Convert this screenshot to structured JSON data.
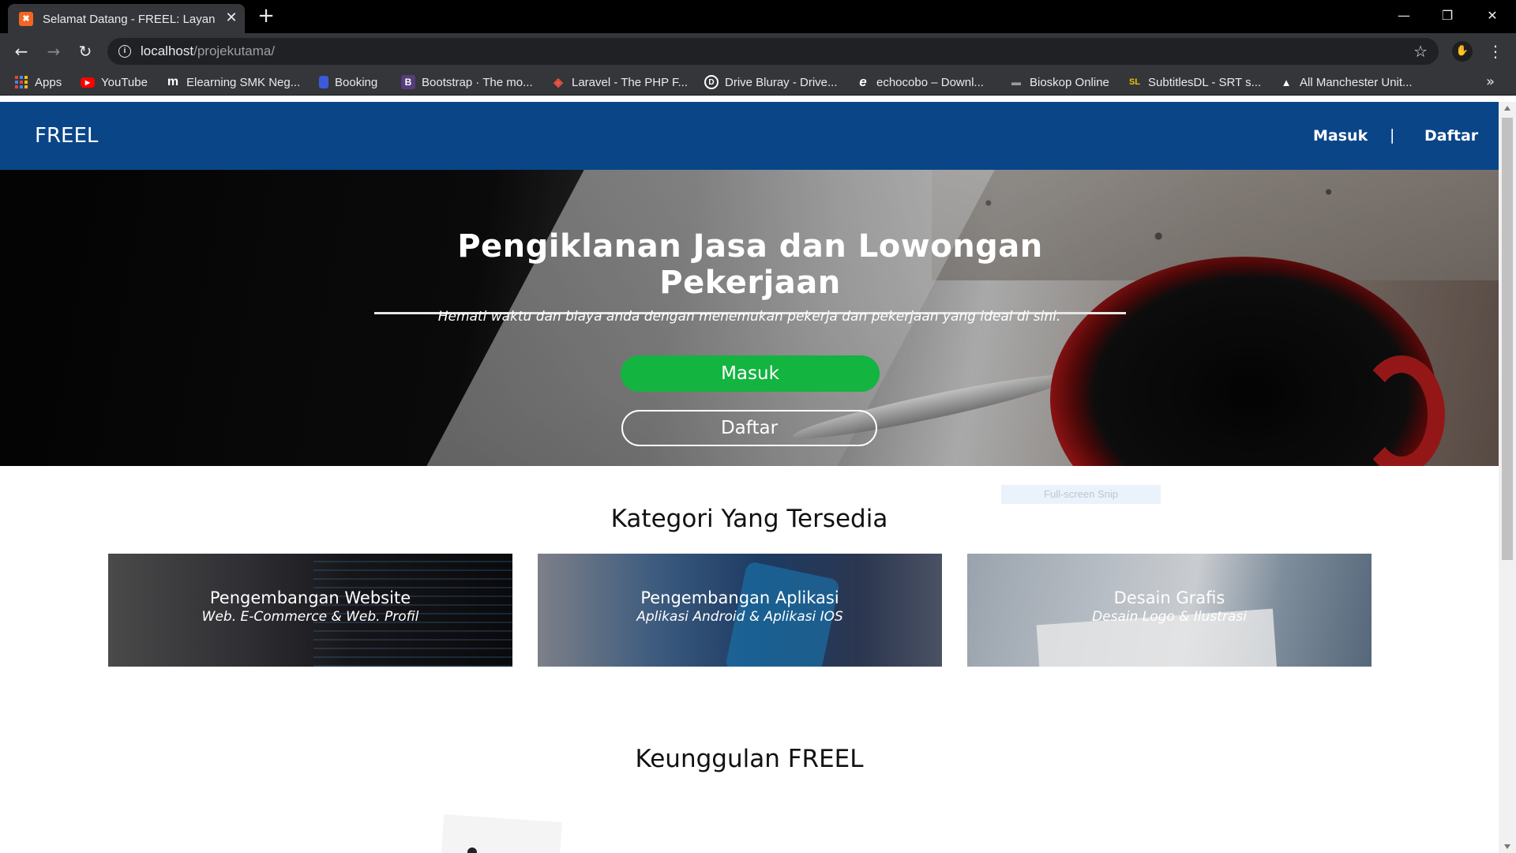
{
  "browser": {
    "tab_title": "Selamat Datang - FREEL: Layanan",
    "tab_favicon": "xampp-icon",
    "new_tab": "+",
    "url_host": "localhost",
    "url_path": "/projekutama/",
    "window_controls": {
      "minimize": "—",
      "restore": "❐",
      "close": "✕"
    },
    "bookmarks": [
      {
        "label": "Apps",
        "icon": "apps-grid-icon"
      },
      {
        "label": "YouTube",
        "icon": "youtube-icon",
        "color": "#ff0000"
      },
      {
        "label": "Elearning SMK Neg...",
        "icon": "moodle-icon",
        "glyph": "m"
      },
      {
        "label": "Booking",
        "icon": "booking-icon",
        "color": "#3b5bdb"
      },
      {
        "label": "Bootstrap · The mo...",
        "icon": "bootstrap-icon",
        "glyph": "B",
        "color": "#563d7c"
      },
      {
        "label": "Laravel - The PHP F...",
        "icon": "laravel-icon",
        "color": "#f05340"
      },
      {
        "label": "Drive Bluray - Drive...",
        "icon": "drive-bluray-icon",
        "glyph": "D"
      },
      {
        "label": "echocobo – Downl...",
        "icon": "echocobo-icon",
        "glyph": "e"
      },
      {
        "label": "Bioskop Online",
        "icon": "bioskop-icon",
        "glyph": "—"
      },
      {
        "label": "SubtitlesDL - SRT s...",
        "icon": "subtitlesdl-icon",
        "glyph": "SL",
        "color": "#f0c000"
      },
      {
        "label": "All Manchester Unit...",
        "icon": "manutd-icon",
        "glyph": "▲"
      }
    ],
    "more_bookmarks": "»"
  },
  "site": {
    "brand": "FREEL",
    "nav": {
      "masuk": "Masuk",
      "separator": "|",
      "daftar": "Daftar"
    },
    "hero": {
      "title": "Pengiklanan Jasa dan Lowongan Pekerjaan",
      "subtitle": "Hemati waktu dan biaya anda dengan menemukan pekerja dan pekerjaan yang ideal di sini.",
      "btn_masuk": "Masuk",
      "btn_daftar": "Daftar"
    },
    "snip_overlay": "Full-screen Snip",
    "categories_title": "Kategori Yang Tersedia",
    "categories": [
      {
        "title": "Pengembangan Website",
        "subtitle": "Web. E-Commerce & Web. Profil"
      },
      {
        "title": "Pengembangan Aplikasi",
        "subtitle": "Aplikasi Android & Aplikasi IOS"
      },
      {
        "title": "Desain Grafis",
        "subtitle": "Desain Logo & Ilustrasi"
      }
    ],
    "advantages_title": "Keunggulan FREEL"
  },
  "colors": {
    "navbar": "#0a4588",
    "masuk_button": "#13b440",
    "chrome_dark": "#35363a"
  }
}
